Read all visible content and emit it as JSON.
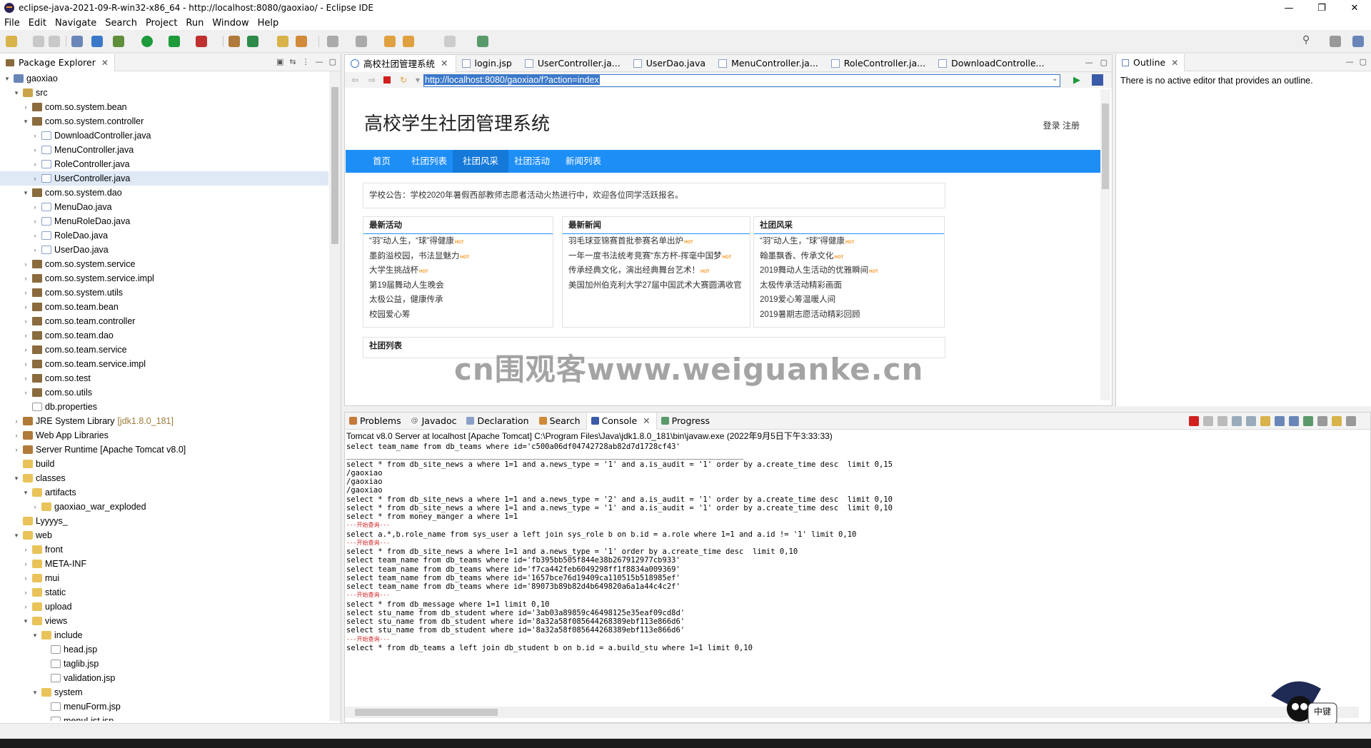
{
  "window": {
    "title": "eclipse-java-2021-09-R-win32-x86_64 - http://localhost:8080/gaoxiao/ - Eclipse IDE"
  },
  "menu": [
    "File",
    "Edit",
    "Navigate",
    "Search",
    "Project",
    "Run",
    "Window",
    "Help"
  ],
  "package_explorer": {
    "tab_label": "Package Explorer",
    "items": [
      {
        "label": "gaoxiao",
        "indent": 0,
        "arrow": "▾",
        "icon": "prj"
      },
      {
        "label": "src",
        "indent": 1,
        "arrow": "▾",
        "icon": "src"
      },
      {
        "label": "com.so.system.bean",
        "indent": 2,
        "arrow": "›",
        "icon": "pkg"
      },
      {
        "label": "com.so.system.controller",
        "indent": 2,
        "arrow": "▾",
        "icon": "pkg"
      },
      {
        "label": "DownloadController.java",
        "indent": 3,
        "arrow": "›",
        "icon": "java"
      },
      {
        "label": "MenuController.java",
        "indent": 3,
        "arrow": "›",
        "icon": "java"
      },
      {
        "label": "RoleController.java",
        "indent": 3,
        "arrow": "›",
        "icon": "java"
      },
      {
        "label": "UserController.java",
        "indent": 3,
        "arrow": "›",
        "icon": "java",
        "selected": true
      },
      {
        "label": "com.so.system.dao",
        "indent": 2,
        "arrow": "▾",
        "icon": "pkg"
      },
      {
        "label": "MenuDao.java",
        "indent": 3,
        "arrow": "›",
        "icon": "java"
      },
      {
        "label": "MenuRoleDao.java",
        "indent": 3,
        "arrow": "›",
        "icon": "java"
      },
      {
        "label": "RoleDao.java",
        "indent": 3,
        "arrow": "›",
        "icon": "java"
      },
      {
        "label": "UserDao.java",
        "indent": 3,
        "arrow": "›",
        "icon": "java"
      },
      {
        "label": "com.so.system.service",
        "indent": 2,
        "arrow": "›",
        "icon": "pkg"
      },
      {
        "label": "com.so.system.service.impl",
        "indent": 2,
        "arrow": "›",
        "icon": "pkg"
      },
      {
        "label": "com.so.system.utils",
        "indent": 2,
        "arrow": "›",
        "icon": "pkg"
      },
      {
        "label": "com.so.team.bean",
        "indent": 2,
        "arrow": "›",
        "icon": "pkg"
      },
      {
        "label": "com.so.team.controller",
        "indent": 2,
        "arrow": "›",
        "icon": "pkg"
      },
      {
        "label": "com.so.team.dao",
        "indent": 2,
        "arrow": "›",
        "icon": "pkg"
      },
      {
        "label": "com.so.team.service",
        "indent": 2,
        "arrow": "›",
        "icon": "pkg"
      },
      {
        "label": "com.so.team.service.impl",
        "indent": 2,
        "arrow": "›",
        "icon": "pkg"
      },
      {
        "label": "com.so.test",
        "indent": 2,
        "arrow": "›",
        "icon": "pkg"
      },
      {
        "label": "com.so.utils",
        "indent": 2,
        "arrow": "›",
        "icon": "pkg"
      },
      {
        "label": "db.properties",
        "indent": 2,
        "arrow": "",
        "icon": "file"
      },
      {
        "label": "JRE System Library",
        "sub": "[jdk1.8.0_181]",
        "indent": 1,
        "arrow": "›",
        "icon": "lib"
      },
      {
        "label": "Web App Libraries",
        "indent": 1,
        "arrow": "›",
        "icon": "lib"
      },
      {
        "label": "Server Runtime [Apache Tomcat v8.0]",
        "indent": 1,
        "arrow": "›",
        "icon": "lib"
      },
      {
        "label": "build",
        "indent": 1,
        "arrow": "",
        "icon": "fld"
      },
      {
        "label": "classes",
        "indent": 1,
        "arrow": "▾",
        "icon": "fld"
      },
      {
        "label": "artifacts",
        "indent": 2,
        "arrow": "▾",
        "icon": "fld"
      },
      {
        "label": "gaoxiao_war_exploded",
        "indent": 3,
        "arrow": "›",
        "icon": "fld"
      },
      {
        "label": "Lyyyys_",
        "indent": 1,
        "arrow": "",
        "icon": "fld"
      },
      {
        "label": "web",
        "indent": 1,
        "arrow": "▾",
        "icon": "fld"
      },
      {
        "label": "front",
        "indent": 2,
        "arrow": "›",
        "icon": "fld"
      },
      {
        "label": "META-INF",
        "indent": 2,
        "arrow": "›",
        "icon": "fld"
      },
      {
        "label": "mui",
        "indent": 2,
        "arrow": "›",
        "icon": "fld"
      },
      {
        "label": "static",
        "indent": 2,
        "arrow": "›",
        "icon": "fld"
      },
      {
        "label": "upload",
        "indent": 2,
        "arrow": "›",
        "icon": "fld"
      },
      {
        "label": "views",
        "indent": 2,
        "arrow": "▾",
        "icon": "fld"
      },
      {
        "label": "include",
        "indent": 3,
        "arrow": "▾",
        "icon": "fld"
      },
      {
        "label": "head.jsp",
        "indent": 4,
        "arrow": "",
        "icon": "file"
      },
      {
        "label": "taglib.jsp",
        "indent": 4,
        "arrow": "",
        "icon": "file"
      },
      {
        "label": "validation.jsp",
        "indent": 4,
        "arrow": "",
        "icon": "file"
      },
      {
        "label": "system",
        "indent": 3,
        "arrow": "▾",
        "icon": "fld"
      },
      {
        "label": "menuForm.jsp",
        "indent": 4,
        "arrow": "",
        "icon": "file"
      },
      {
        "label": "menuList.jsp",
        "indent": 4,
        "arrow": "",
        "icon": "file"
      }
    ]
  },
  "editor": {
    "tabs": [
      "高校社团管理系统",
      "login.jsp",
      "UserController.ja...",
      "UserDao.java",
      "MenuController.ja...",
      "RoleController.ja...",
      "DownloadControlle..."
    ],
    "url": "http://localhost:8080/gaoxiao/f?action=index"
  },
  "site": {
    "title": "高校学生社团管理系统",
    "login_links": "登录 注册",
    "nav": [
      "首页",
      "社团列表",
      "社团风采",
      "社团活动",
      "新闻列表"
    ],
    "notice": "学校公告：学校2020年暑假西部教师志愿者活动火热进行中，欢迎各位同学活跃报名。",
    "hot_label": "HOT",
    "boxes": [
      {
        "title": "最新活动",
        "items": [
          {
            "t": "“羽”动人生，“球”得健康",
            "hot": true
          },
          {
            "t": "墨韵溢校园，书法显魅力",
            "hot": true
          },
          {
            "t": "大学生挑战杯",
            "hot": true
          },
          {
            "t": "第19届舞动人生晚会",
            "hot": false
          },
          {
            "t": "太极公益，健康传承",
            "hot": false
          },
          {
            "t": "校园爱心筹",
            "hot": false
          }
        ]
      },
      {
        "title": "最新新闻",
        "items": [
          {
            "t": "羽毛球亚锦赛首批参赛名单出炉",
            "hot": true
          },
          {
            "t": "一年一度书法统考竞赛“东方杯-挥毫中国梦",
            "hot": true
          },
          {
            "t": "传承经典文化，演出经典舞台艺术！",
            "hot": true
          },
          {
            "t": "美国加州伯克利大学27届中国武术大赛圆满收官",
            "hot": false
          }
        ]
      },
      {
        "title": "社团风采",
        "items": [
          {
            "t": "“羽”动人生，“球”得健康",
            "hot": true
          },
          {
            "t": "翰墨飘香、传承文化",
            "hot": true
          },
          {
            "t": "2019舞动人生活动的优雅瞬间",
            "hot": true
          },
          {
            "t": "太极传承活动精彩画面",
            "hot": false
          },
          {
            "t": "2019爱心筹温暖人间",
            "hot": false
          },
          {
            "t": "2019暑期志愿活动精彩回顾",
            "hot": false
          }
        ]
      }
    ],
    "team_list_title": "社团列表"
  },
  "outline": {
    "tab_label": "Outline",
    "message": "There is no active editor that provides an outline."
  },
  "console": {
    "tabs": [
      "Problems",
      "Javadoc",
      "Declaration",
      "Search",
      "Console",
      "Progress"
    ],
    "header": "Tomcat v8.0 Server at localhost [Apache Tomcat] C:\\Program Files\\Java\\jdk1.8.0_181\\bin\\javaw.exe  (2022年9月5日下午3:33:33)",
    "lines": [
      {
        "t": "select team_name from db_teams where id='c500a06df04742728ab82d7d1728cf43'"
      },
      {
        "t": "________________________________________________________________________________________"
      },
      {
        "t": "select * from db_site_news a where 1=1 and a.news_type = '1' and a.is_audit = '1' order by a.create_time desc  limit 0,15"
      },
      {
        "t": "/gaoxiao"
      },
      {
        "t": "/gaoxiao"
      },
      {
        "t": "/gaoxiao"
      },
      {
        "t": "select * from db_site_news a where 1=1 and a.news_type = '2' and a.is_audit = '1' order by a.create_time desc  limit 0,10"
      },
      {
        "t": "select * from db_site_news a where 1=1 and a.news_type = '1' and a.is_audit = '1' order by a.create_time desc  limit 0,10"
      },
      {
        "t": "select * from money_manger a where 1=1"
      },
      {
        "t": "---开始查询---",
        "hint": true
      },
      {
        "t": "select a.*,b.role_name from sys_user a left join sys_role b on b.id = a.role where 1=1 and a.id != '1' limit 0,10"
      },
      {
        "t": "---开始查询---",
        "hint": true
      },
      {
        "t": "select * from db_site_news a where 1=1 and a.news_type = '1' order by a.create_time desc  limit 0,10"
      },
      {
        "t": "select team_name from db_teams where id='fb395bb505f844e38b267912977cb933'"
      },
      {
        "t": "select team_name from db_teams where id='f7ca442feb6049298ff1f8834a009369'"
      },
      {
        "t": "select team_name from db_teams where id='1657bce76d19409ca110515b518985ef'"
      },
      {
        "t": "select team_name from db_teams where id='89073b89b82d4b649820a6a1a44c4c2f'"
      },
      {
        "t": "---开始查询---",
        "hint": true
      },
      {
        "t": "select * from db_message where 1=1 limit 0,10"
      },
      {
        "t": "select stu_name from db_student where id='3ab03a89859c46498125e35eaf09cd8d'"
      },
      {
        "t": "select stu_name from db_student where id='8a32a58f085644268389ebf113e866d6'"
      },
      {
        "t": "select stu_name from db_student where id='8a32a58f085644268389ebf113e866d6'"
      },
      {
        "t": "---开始查询---",
        "hint": true
      },
      {
        "t": "select * from db_teams a left join db_student b on b.id = a.build_stu where 1=1 limit 0,10"
      }
    ]
  },
  "watermark": "cn围观客www.weiguanke.cn",
  "mascot_text": "中键",
  "colors": {
    "accent": "#1e8ef7",
    "url_highlight": "#3b78c9",
    "hot": "#f7941e",
    "hint": "#d02020"
  }
}
